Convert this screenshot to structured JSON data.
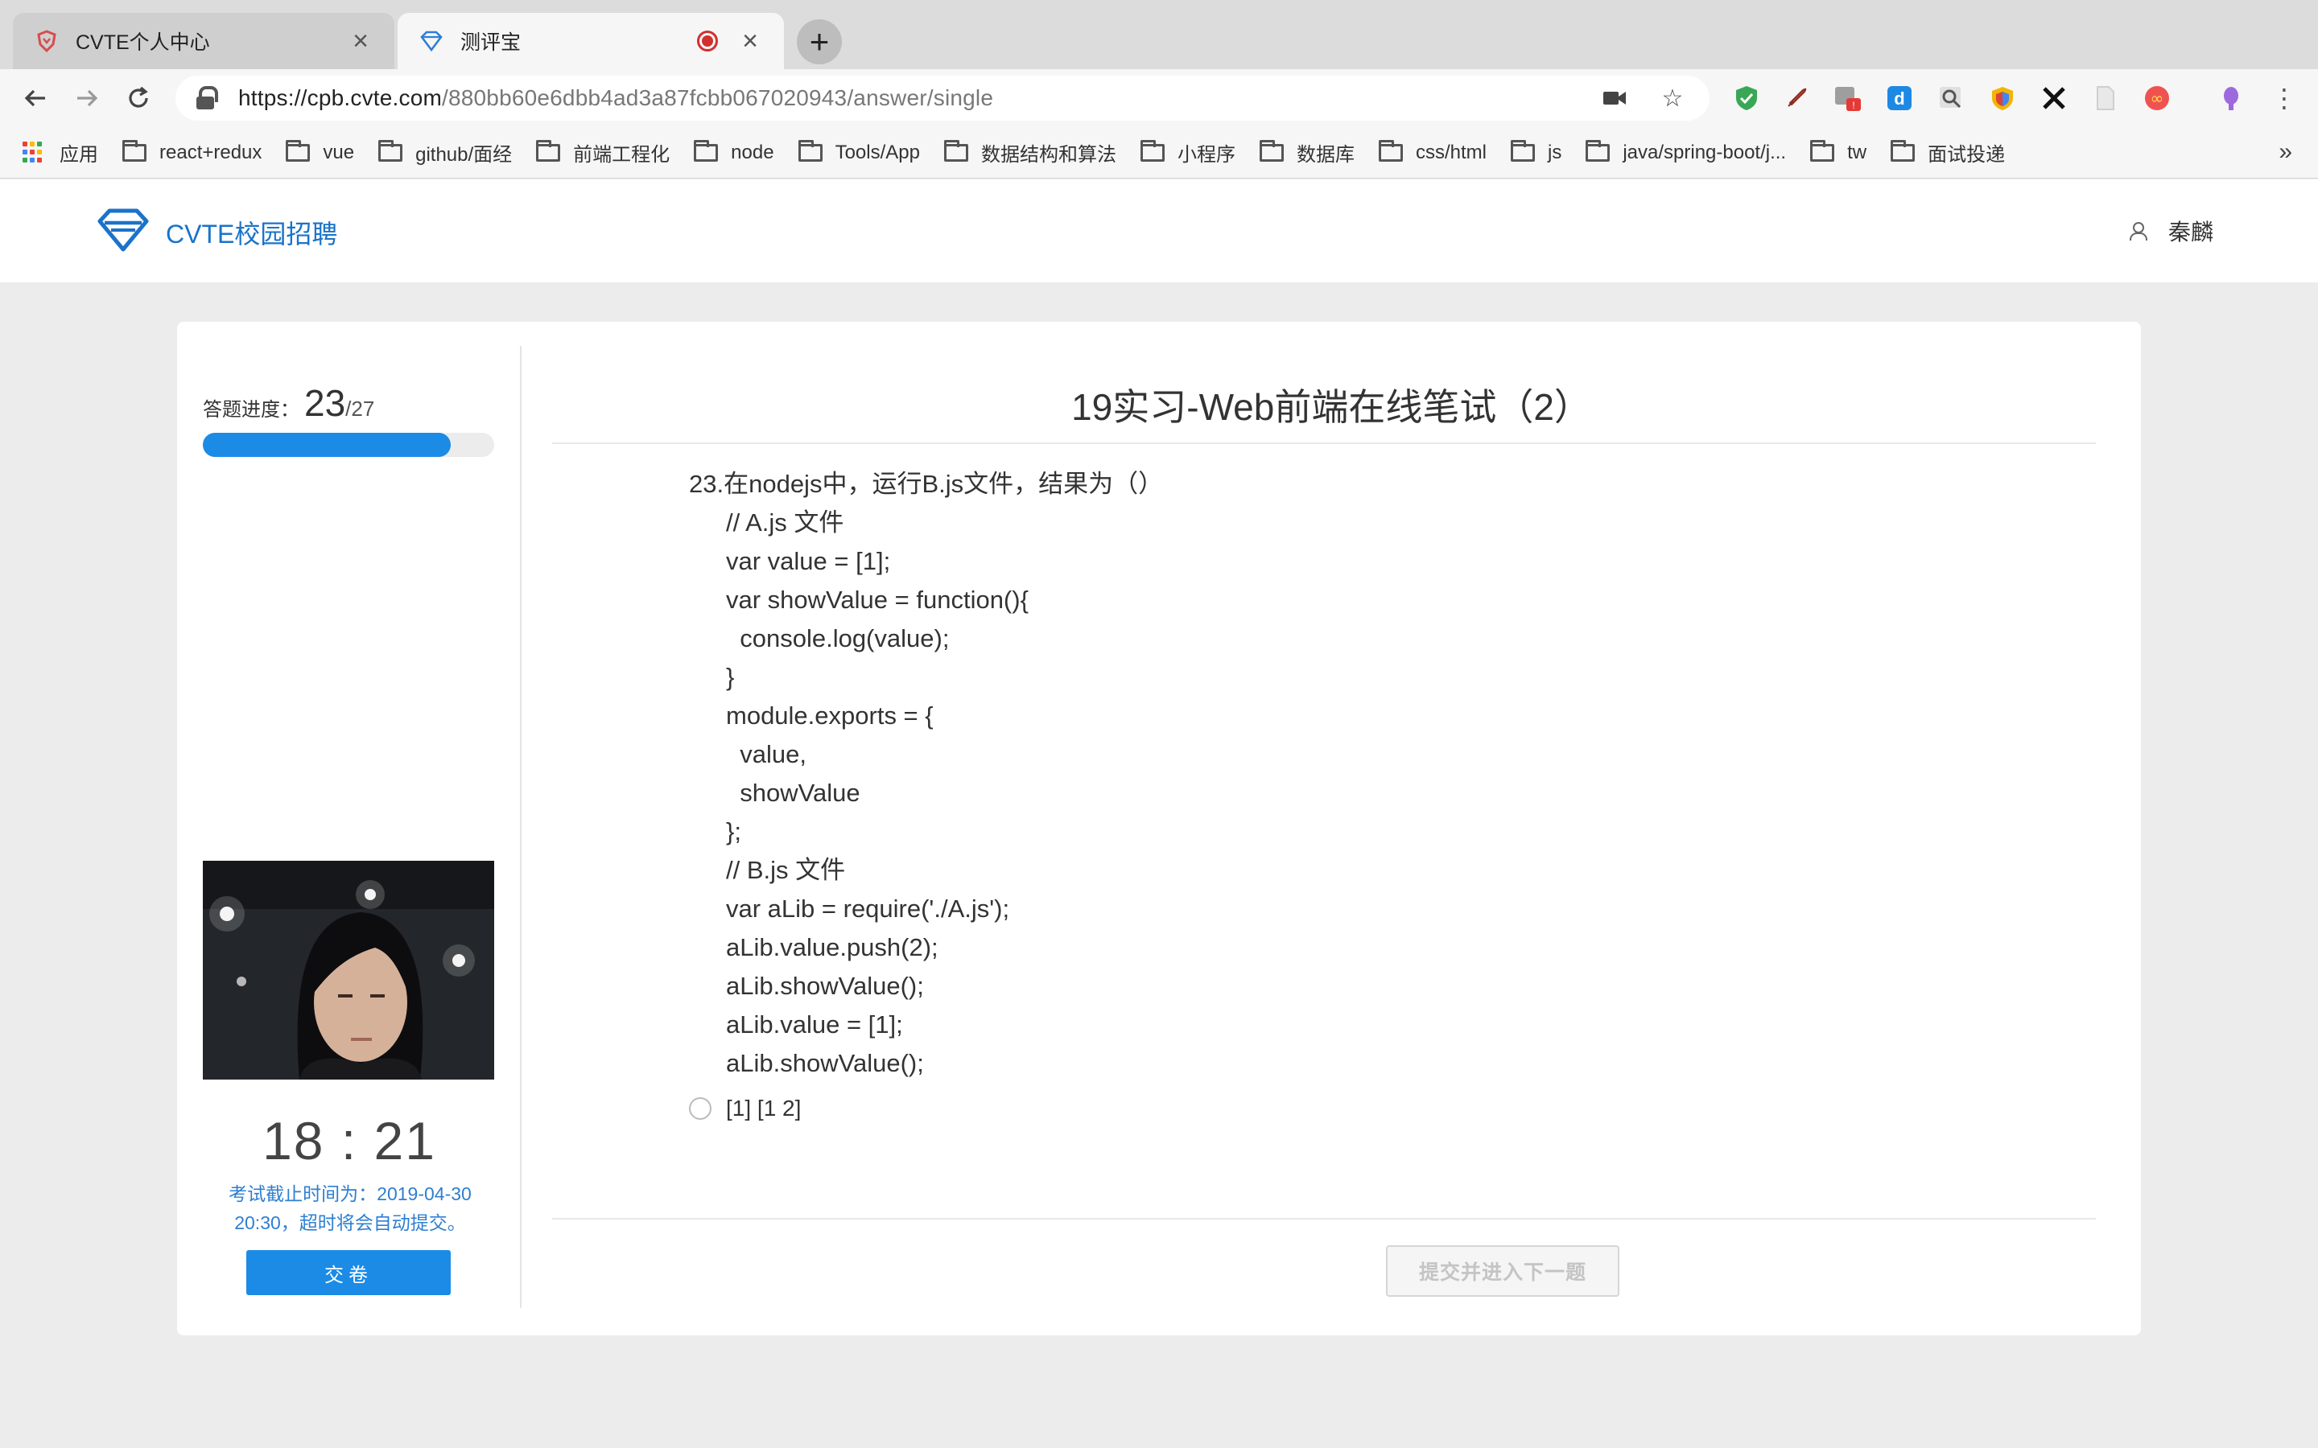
{
  "browser": {
    "tabs": [
      {
        "title": "CVTE个人中心",
        "icon": "cvte-shield-icon"
      },
      {
        "title": "测评宝",
        "icon": "diamond-icon",
        "recording": true
      }
    ],
    "url_host": "https://cpb.cvte.com",
    "url_path": "/880bb60e6dbb4ad3a87fcbb067020943/answer/single",
    "bookmarks": [
      "应用",
      "react+redux",
      "vue",
      "github/面经",
      "前端工程化",
      "node",
      "Tools/App",
      "数据结构和算法",
      "小程序",
      "数据库",
      "css/html",
      "js",
      "java/spring-boot/j...",
      "tw",
      "面试投递"
    ],
    "bookmarks_more": "»"
  },
  "site": {
    "brand": "CVTE校园招聘",
    "user_name": "秦麟"
  },
  "sidebar": {
    "progress_label": "答题进度：",
    "progress_current": "23",
    "progress_total": "/27",
    "progress_fraction": 0.852,
    "timer": "18 : 21",
    "deadline_line1": "考试截止时间为：2019-04-30",
    "deadline_line2": "20:30，超时将会自动提交。",
    "submit_exam_label": "交卷"
  },
  "exam": {
    "title": "19实习-Web前端在线笔试（2）",
    "question_title": "23.在nodejs中，运行B.js文件，结果为（）",
    "code_lines": [
      "// A.js 文件",
      "var value = [1];",
      "var showValue = function(){",
      "  console.log(value);",
      "}",
      "module.exports = {",
      "  value,",
      "  showValue",
      "};",
      "",
      "",
      "// B.js 文件",
      "var aLib = require('./A.js');",
      "aLib.value.push(2);",
      "aLib.showValue();",
      "aLib.value = [1];",
      "aLib.showValue();"
    ],
    "first_option_partial": "[1] [1    2]",
    "next_button_label": "提交并进入下一题"
  },
  "colors": {
    "accent": "#1b8be6",
    "brand_text": "#1a73c9",
    "deadline_text": "#2e7fd0"
  }
}
